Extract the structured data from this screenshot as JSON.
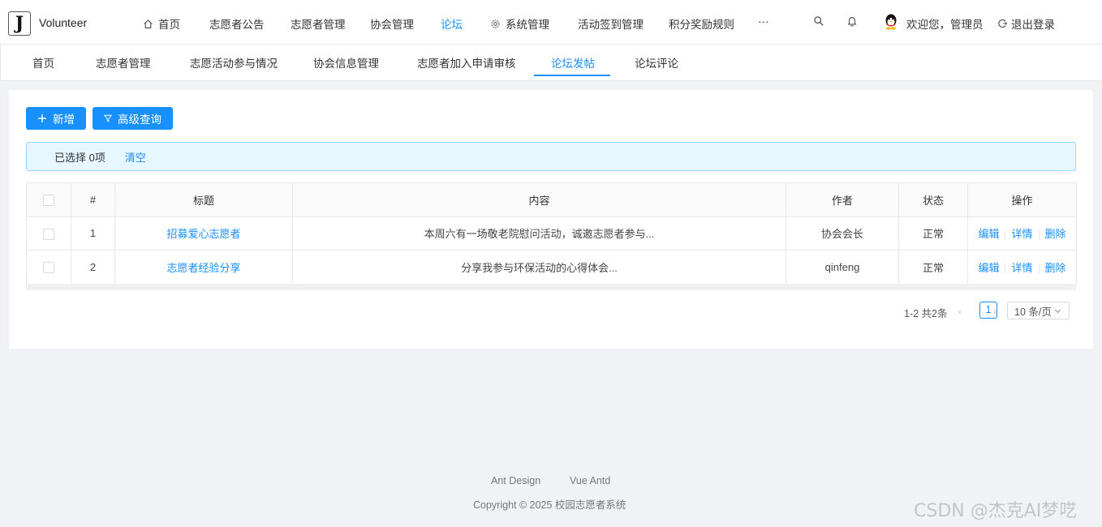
{
  "header": {
    "logo_letter": "J",
    "app_name": "Volunteer",
    "nav": [
      {
        "label": "首页",
        "icon": "home-icon"
      },
      {
        "label": "志愿者公告"
      },
      {
        "label": "志愿者管理"
      },
      {
        "label": "协会管理"
      },
      {
        "label": "论坛",
        "active": true
      },
      {
        "label": "系统管理",
        "icon": "gear-icon"
      },
      {
        "label": "活动签到管理"
      },
      {
        "label": "积分奖励规则"
      },
      {
        "label": "···"
      }
    ],
    "welcome": "欢迎您，管理员",
    "logout": "退出登录"
  },
  "tabs": [
    {
      "label": "首页"
    },
    {
      "label": "志愿者管理"
    },
    {
      "label": "志愿活动参与情况"
    },
    {
      "label": "协会信息管理"
    },
    {
      "label": "志愿者加入申请审核"
    },
    {
      "label": "论坛发帖",
      "active": true
    },
    {
      "label": "论坛评论"
    }
  ],
  "toolbar": {
    "add_label": "新增",
    "query_label": "高级查询"
  },
  "selection": {
    "text": "已选择 0项",
    "clear": "清空"
  },
  "table": {
    "columns": [
      "#",
      "标题",
      "内容",
      "作者",
      "状态",
      "操作"
    ],
    "rows": [
      {
        "index": "1",
        "title": "招募爱心志愿者",
        "content": "本周六有一场敬老院慰问活动，诚邀志愿者参与...",
        "author": "协会会长",
        "status": "正常"
      },
      {
        "index": "2",
        "title": "志愿者经验分享",
        "content": "分享我参与环保活动的心得体会...",
        "author": "qinfeng",
        "status": "正常"
      }
    ],
    "actions": {
      "edit": "编辑",
      "detail": "详情",
      "delete": "删除"
    }
  },
  "pagination": {
    "total": "1-2 共2条",
    "current": "1",
    "page_size": "10 条/页"
  },
  "footer": {
    "links": [
      "Ant Design",
      "Vue Antd"
    ],
    "copyright": "Copyright © 2025 校园志愿者系统"
  },
  "watermark": "CSDN @杰克AI梦呓",
  "colors": {
    "primary": "#1890ff",
    "background": "#f0f2f5"
  }
}
